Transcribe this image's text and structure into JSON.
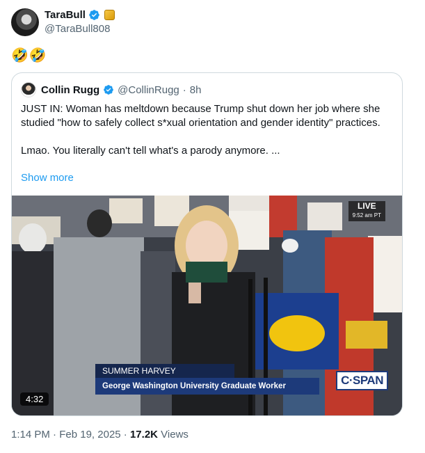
{
  "author": {
    "display_name": "TaraBull",
    "handle": "@TaraBull808",
    "verified_icon": "verified-badge-icon",
    "affiliate_icon": "gold-badge-icon"
  },
  "tweet": {
    "text": "🤣🤣"
  },
  "quote": {
    "author_name": "Collin Rugg",
    "handle": "@CollinRugg",
    "separator": "·",
    "age": "8h",
    "paragraph1": "JUST IN: Woman has meltdown because Trump shut down her job where she studied \"how to safely collect s*xual orientation and gender identity\" practices.",
    "paragraph2": "Lmao. You literally can't tell what's a parody anymore. ...",
    "show_more": "Show more",
    "media": {
      "live_label": "LIVE",
      "live_time": "9:52 am PT",
      "lower_third_name": "SUMMER HARVEY",
      "lower_third_title": "George Washington University Graduate Worker",
      "network_logo": "C·SPAN",
      "duration": "4:32"
    }
  },
  "meta": {
    "time": "1:14 PM",
    "dot1": "·",
    "date": "Feb 19, 2025",
    "dot2": "·",
    "views_count": "17.2K",
    "views_label": "Views"
  },
  "colors": {
    "link": "#1d9bf0",
    "secondary_text": "#536471",
    "border": "#cfd9de",
    "cspan_blue": "#1d3a7a"
  }
}
